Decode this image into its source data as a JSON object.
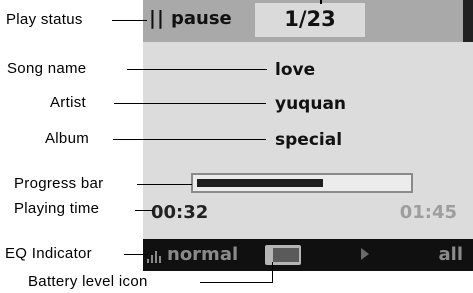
{
  "status_bar": {
    "play_state_glyph": "||",
    "play_state": "pause",
    "track_position": "1/23"
  },
  "now_playing": {
    "song": "love",
    "artist": "yuquan",
    "album": "special"
  },
  "progress": {
    "fraction": 0.6,
    "current_time": "00:32",
    "total_time": "01:45"
  },
  "bottom_bar": {
    "eq_mode": "normal",
    "battery_level": 0.75,
    "transport_icon": "play-icon",
    "repeat_mode": "all"
  },
  "callouts": [
    {
      "id": "play-status",
      "label": "Play status"
    },
    {
      "id": "song-name",
      "label": "Song name"
    },
    {
      "id": "artist",
      "label": "Artist"
    },
    {
      "id": "album",
      "label": "Album"
    },
    {
      "id": "progress-bar",
      "label": "Progress bar"
    },
    {
      "id": "playing-time",
      "label": "Playing time"
    },
    {
      "id": "eq-indicator",
      "label": "EQ Indicator"
    },
    {
      "id": "battery-level-icon",
      "label": "Battery level icon"
    }
  ]
}
